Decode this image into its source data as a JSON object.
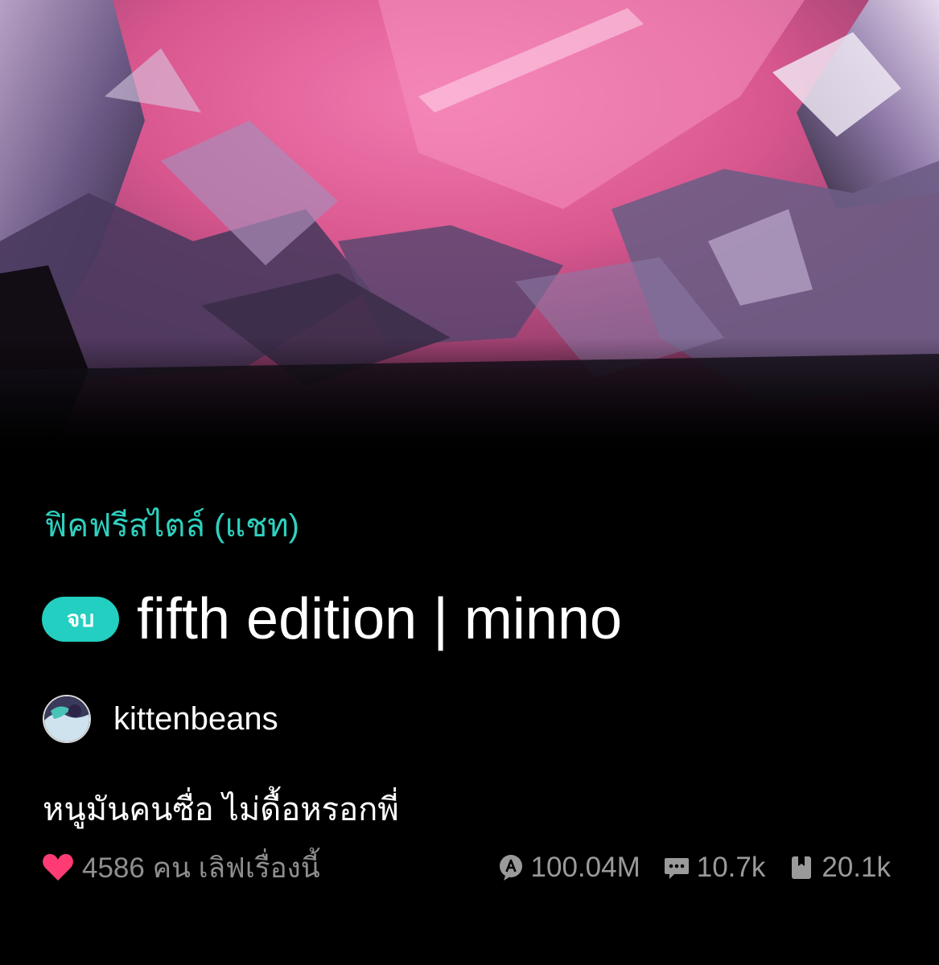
{
  "novel": {
    "category": "ฟิคฟรีสไตล์ (แชท)",
    "status_badge": "จบ",
    "title": "fifth edition | minno",
    "author": "kittenbeans",
    "synopsis": "หนูมันคนซื่อ ไม่ดื้อหรอกพี่",
    "likes_text": "4586 คน เลิฟเรื่องนี้"
  },
  "stats": {
    "views": "100.04M",
    "comments": "10.7k",
    "bookmarks": "20.1k"
  },
  "icons": {
    "like": "heart-icon",
    "views": "view-count-icon",
    "comments": "comment-icon",
    "bookmarks": "bookmark-icon"
  },
  "colors": {
    "accent": "#2fd1c0",
    "heart": "#ff3b74",
    "muted": "#8f8f8f"
  }
}
